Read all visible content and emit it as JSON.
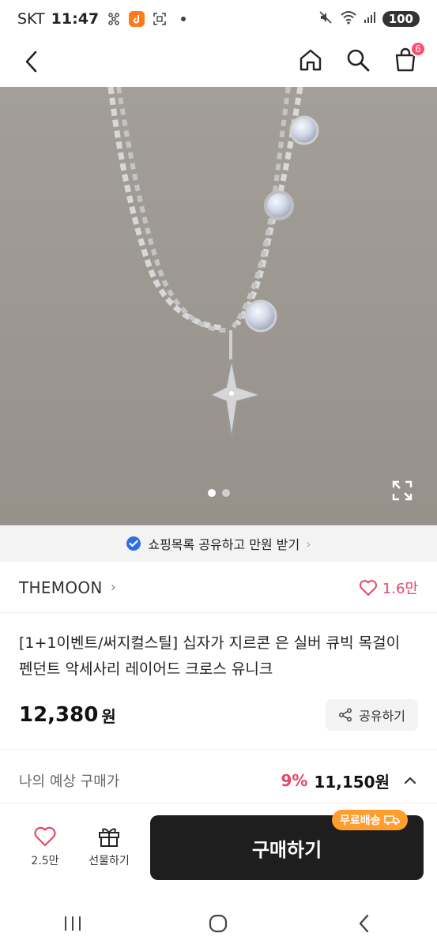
{
  "status_bar": {
    "carrier": "SKT",
    "time": "11:47",
    "battery": "100",
    "icons": [
      "grid-icon",
      "app-orange-icon",
      "scan-icon",
      "dot-icon",
      "mute-icon",
      "wifi-icon",
      "signal-icon"
    ]
  },
  "header": {
    "cart_count": "6"
  },
  "carousel": {
    "current_index": 1,
    "total": 2
  },
  "banner": {
    "text": "쇼핑목록 공유하고 만원 받기",
    "chevron": "›"
  },
  "brand": {
    "name": "THEMOON",
    "chevron": "›",
    "likes": "1.6만"
  },
  "product": {
    "title": "[1+1이벤트/써지컬스틸] 십자가 지르콘 은 실버 큐빅 목걸이 펜던트 악세사리 레이어드 크로스 유니크",
    "price": "12,380",
    "price_unit": "원",
    "share_label": "공유하기"
  },
  "expected": {
    "label": "나의 예상 구매가",
    "discount": "9%",
    "price": "11,150원"
  },
  "bottom_bar": {
    "wish_count": "2.5만",
    "gift_label": "선물하기",
    "buy_label": "구매하기",
    "free_shipping": "무료배송"
  },
  "colors": {
    "accent_pink": "#e5476a",
    "badge_orange": "#ff9d2f",
    "buy_button": "#1e1e1e"
  }
}
